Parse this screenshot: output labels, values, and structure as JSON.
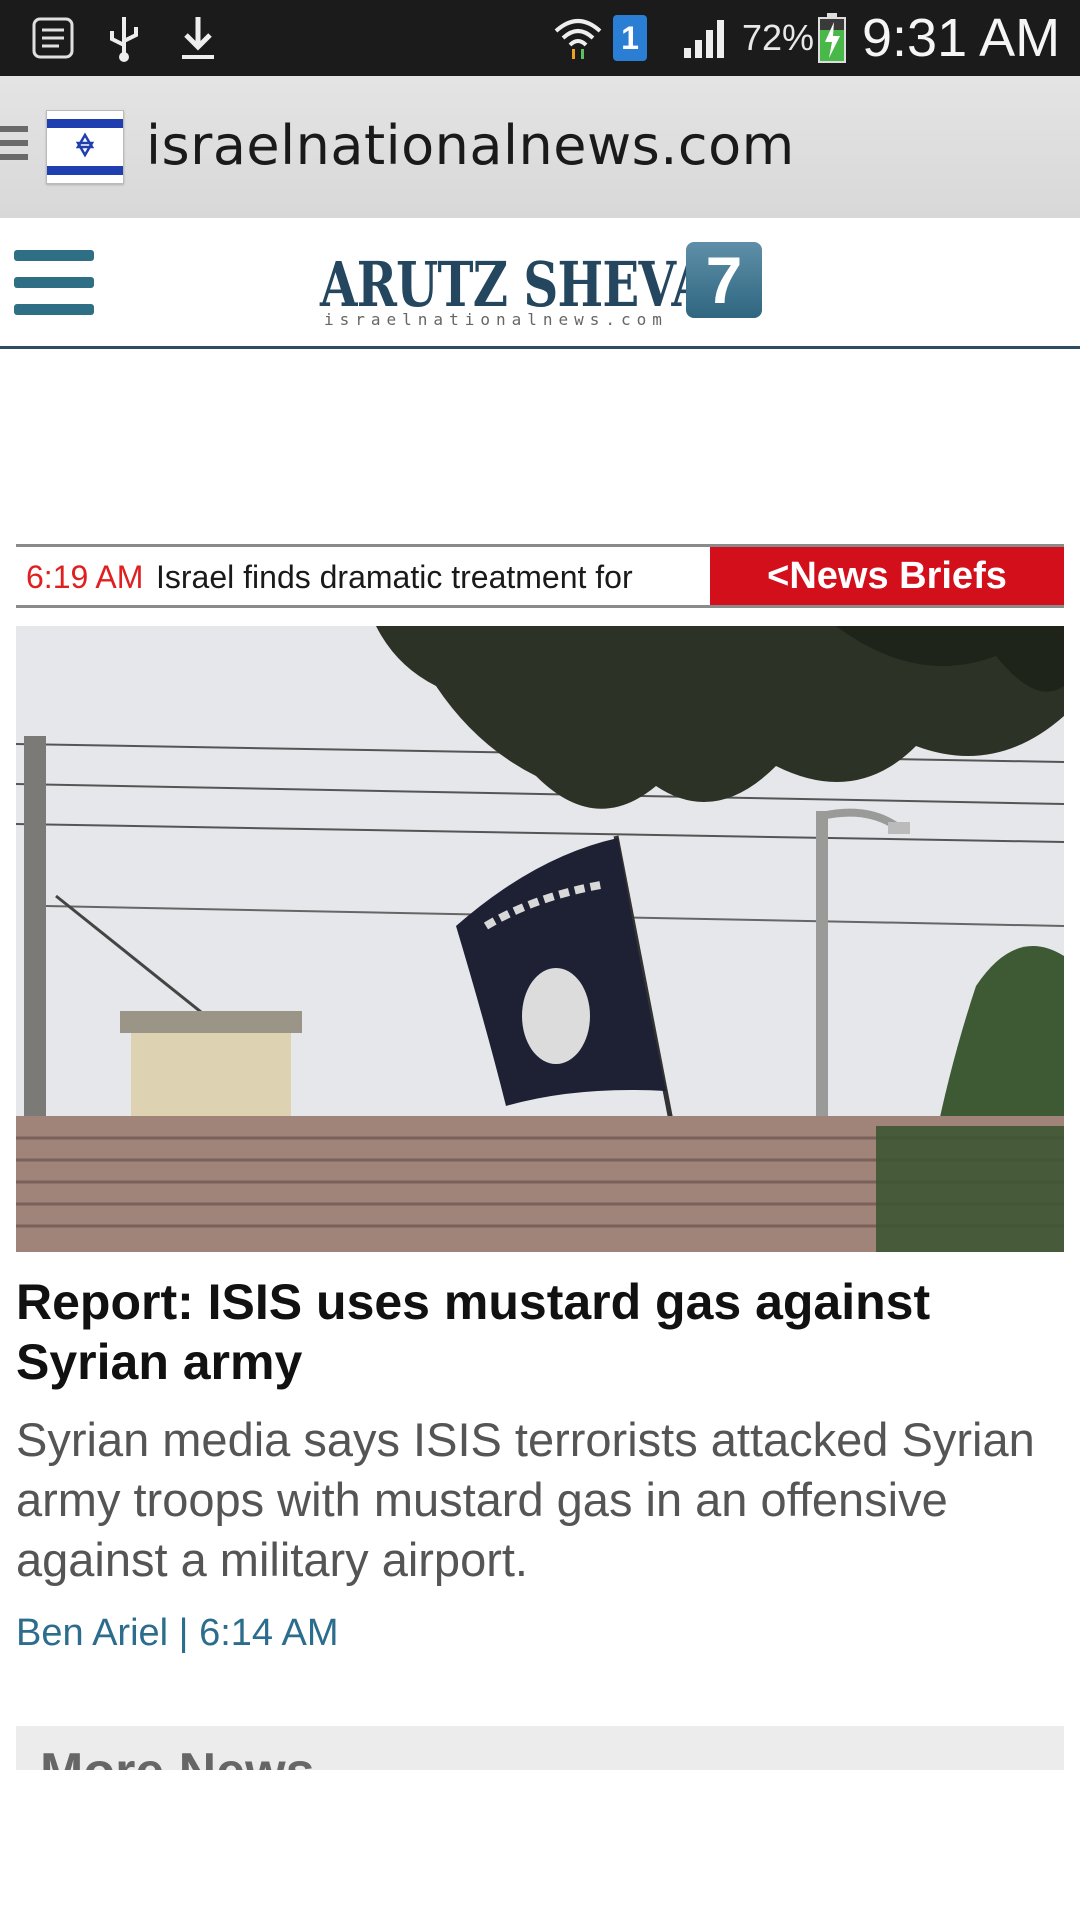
{
  "status_bar": {
    "battery_percent": "72%",
    "time": "9:31 AM",
    "notification_badge": "1",
    "icons": [
      "notes-icon",
      "usb-icon",
      "download-icon",
      "wifi-icon",
      "signal-icon",
      "battery-charging-icon"
    ]
  },
  "browser": {
    "url": "israelnationalnews.com",
    "favicon": "israel-flag-icon"
  },
  "site": {
    "logo_text": "ARUTZ SHEVA",
    "logo_number": "7",
    "logo_subtext": "israelnationalnews.com",
    "accent_color": "#2e4d63"
  },
  "ticker": {
    "time": "6:19 AM",
    "text": "Israel finds dramatic treatment for",
    "button_label": "<News Briefs",
    "button_color": "#d40f1c"
  },
  "article": {
    "headline": "Report: ISIS uses mustard gas against Syrian army",
    "summary": "Syrian media says ISIS terrorists attacked Syrian army troops with mustard gas in an offensive against a military airport.",
    "byline": "Ben Ariel | 6:14 AM"
  },
  "more_news": {
    "label": "More News"
  }
}
